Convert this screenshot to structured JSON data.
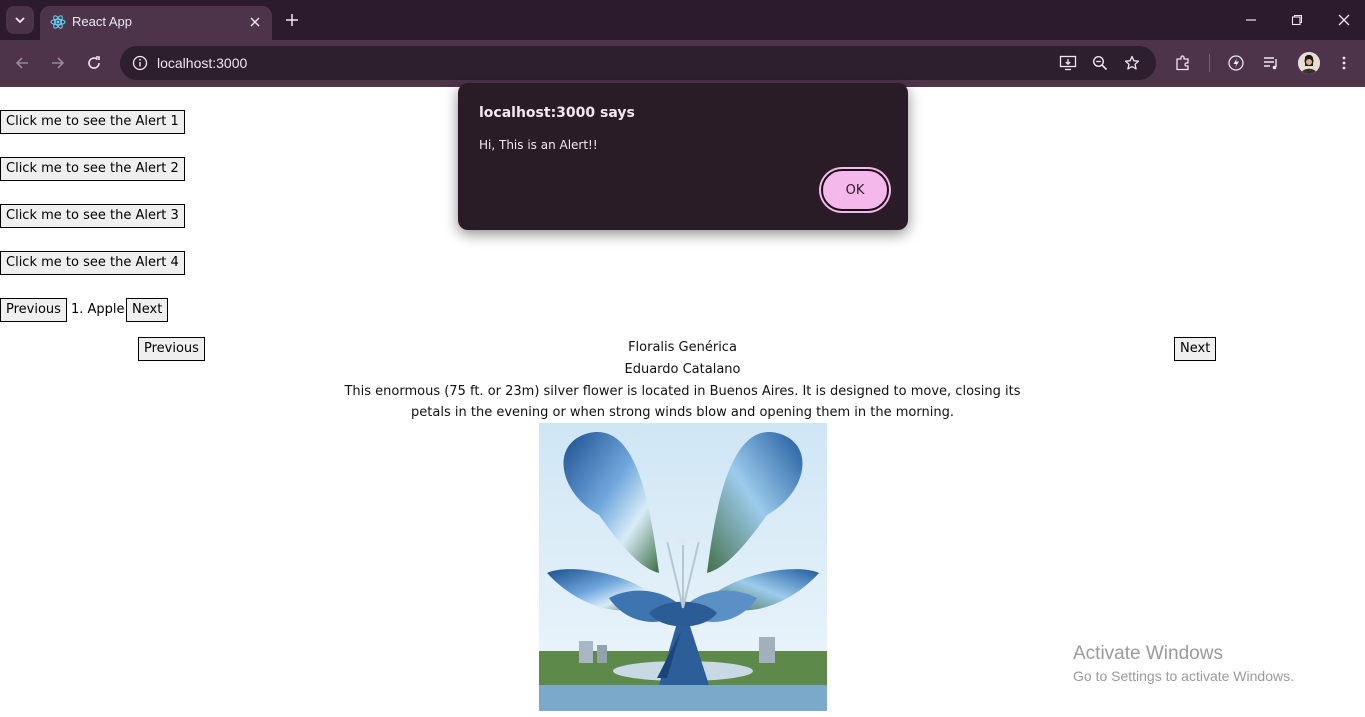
{
  "browser": {
    "tab_title": "React App",
    "url": "localhost:3000"
  },
  "page": {
    "alert_buttons": [
      "Click me to see the Alert 1",
      "Click me to see the Alert 2",
      "Click me to see the Alert 3",
      "Click me to see the Alert 4"
    ],
    "fruit_pager": {
      "prev_label": "Previous",
      "current": "1. Apple",
      "next_label": "Next"
    },
    "gallery": {
      "prev_label": "Previous",
      "next_label": "Next",
      "title": "Floralis Genérica",
      "artist": "Eduardo Catalano",
      "description_line1": "This enormous (75 ft. or 23m) silver flower is located in Buenos Aires. It is designed to move, closing its",
      "description_line2": "petals in the evening or when strong winds blow and opening them in the morning."
    }
  },
  "alert_dialog": {
    "title": "localhost:3000 says",
    "message": "Hi, This is an Alert!!",
    "ok_label": "OK"
  },
  "watermark": {
    "title": "Activate Windows",
    "subtitle": "Go to Settings to activate Windows."
  },
  "colors": {
    "tabstrip_bg": "#2b1b2c",
    "toolbar_bg": "#4d344b",
    "dialog_bg": "#2a1c27",
    "ok_button": "#f5b8ea"
  },
  "icons": [
    "tab-search-icon",
    "react-favicon-icon",
    "close-icon",
    "plus-icon",
    "minimize-icon",
    "restore-icon",
    "back-icon",
    "forward-icon",
    "reload-icon",
    "site-info-icon",
    "install-app-icon",
    "zoom-icon",
    "bookmark-star-icon",
    "extensions-icon",
    "performance-icon",
    "media-controls-icon",
    "profile-avatar",
    "more-menu-icon"
  ]
}
